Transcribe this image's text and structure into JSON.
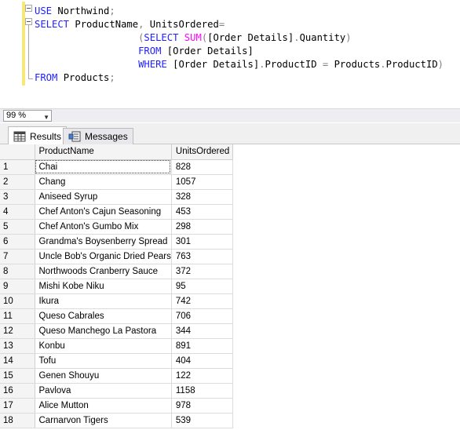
{
  "editor": {
    "lines": [
      [
        [
          "kw",
          "USE"
        ],
        [
          "t",
          " Northwind"
        ],
        [
          "op",
          ";"
        ]
      ],
      [
        [
          "kw",
          "SELECT"
        ],
        [
          "t",
          " ProductName"
        ],
        [
          "op",
          ","
        ],
        [
          "t",
          " UnitsOrdered"
        ],
        [
          "op",
          "="
        ]
      ],
      [
        [
          "t",
          "                  "
        ],
        [
          "op",
          "("
        ],
        [
          "kw",
          "SELECT"
        ],
        [
          "t",
          " "
        ],
        [
          "fn",
          "SUM"
        ],
        [
          "op",
          "("
        ],
        [
          "t",
          "[Order Details]"
        ],
        [
          "op",
          "."
        ],
        [
          "t",
          "Quantity"
        ],
        [
          "op",
          ")"
        ]
      ],
      [
        [
          "t",
          "                  "
        ],
        [
          "kw",
          "FROM"
        ],
        [
          "t",
          " [Order Details]"
        ]
      ],
      [
        [
          "t",
          "                  "
        ],
        [
          "kw",
          "WHERE"
        ],
        [
          "t",
          " [Order Details]"
        ],
        [
          "op",
          "."
        ],
        [
          "t",
          "ProductID "
        ],
        [
          "op",
          "="
        ],
        [
          "t",
          " Products"
        ],
        [
          "op",
          "."
        ],
        [
          "t",
          "ProductID"
        ],
        [
          "op",
          ")"
        ]
      ],
      [
        [
          "kw",
          "FROM"
        ],
        [
          "t",
          " Products"
        ],
        [
          "op",
          ";"
        ]
      ]
    ]
  },
  "zoom": {
    "value": "99 %"
  },
  "tabs": [
    {
      "label": "Results",
      "icon": "grid-icon",
      "active": true
    },
    {
      "label": "Messages",
      "icon": "messages-icon",
      "active": false
    }
  ],
  "grid": {
    "columns": [
      "ProductName",
      "UnitsOrdered"
    ],
    "rows": [
      [
        "1",
        "Chai",
        "828"
      ],
      [
        "2",
        "Chang",
        "1057"
      ],
      [
        "3",
        "Aniseed Syrup",
        "328"
      ],
      [
        "4",
        "Chef Anton's Cajun Seasoning",
        "453"
      ],
      [
        "5",
        "Chef Anton's Gumbo Mix",
        "298"
      ],
      [
        "6",
        "Grandma's Boysenberry Spread",
        "301"
      ],
      [
        "7",
        "Uncle Bob's Organic Dried Pears",
        "763"
      ],
      [
        "8",
        "Northwoods Cranberry Sauce",
        "372"
      ],
      [
        "9",
        "Mishi Kobe Niku",
        "95"
      ],
      [
        "10",
        "Ikura",
        "742"
      ],
      [
        "11",
        "Queso Cabrales",
        "706"
      ],
      [
        "12",
        "Queso Manchego La Pastora",
        "344"
      ],
      [
        "13",
        "Konbu",
        "891"
      ],
      [
        "14",
        "Tofu",
        "404"
      ],
      [
        "15",
        "Genen Shouyu",
        "122"
      ],
      [
        "16",
        "Pavlova",
        "1158"
      ],
      [
        "17",
        "Alice Mutton",
        "978"
      ],
      [
        "18",
        "Carnarvon Tigers",
        "539"
      ]
    ]
  },
  "colors": {
    "keyword": "#1f1fff",
    "function": "#ff00ff",
    "operator": "#808080",
    "change_bar": "#f6e97a"
  }
}
